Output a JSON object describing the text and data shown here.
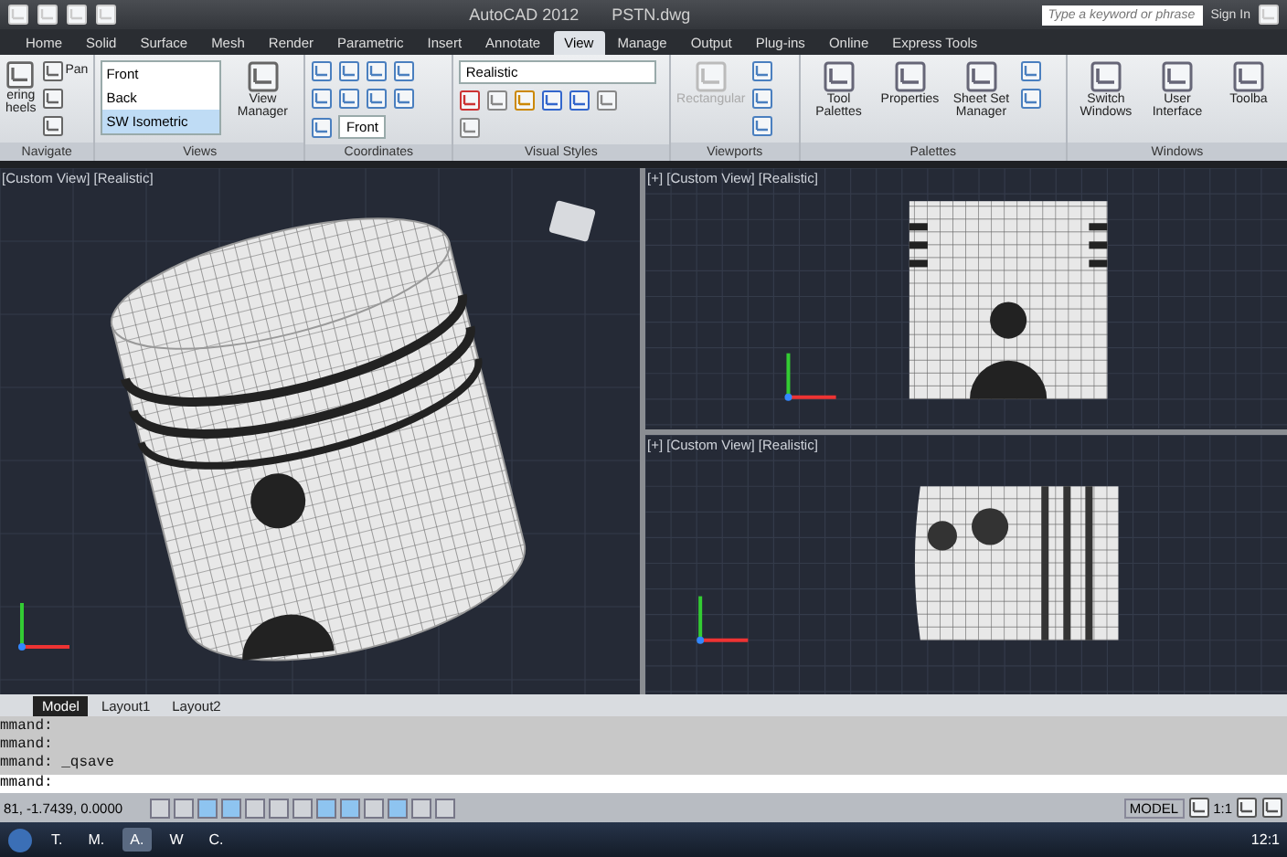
{
  "title_bar": {
    "app": "AutoCAD 2012",
    "file": "PSTN.dwg",
    "search": {
      "placeholder": "Type a keyword or phrase"
    },
    "sign_in": "Sign In"
  },
  "ribbon_tabs": [
    {
      "label": "Home",
      "selected": false
    },
    {
      "label": "Solid",
      "selected": false
    },
    {
      "label": "Surface",
      "selected": false
    },
    {
      "label": "Mesh",
      "selected": false
    },
    {
      "label": "Render",
      "selected": false
    },
    {
      "label": "Parametric",
      "selected": false
    },
    {
      "label": "Insert",
      "selected": false
    },
    {
      "label": "Annotate",
      "selected": false
    },
    {
      "label": "View",
      "selected": true
    },
    {
      "label": "Manage",
      "selected": false
    },
    {
      "label": "Output",
      "selected": false
    },
    {
      "label": "Plug-ins",
      "selected": false
    },
    {
      "label": "Online",
      "selected": false
    },
    {
      "label": "Express Tools",
      "selected": false
    }
  ],
  "ribbon": {
    "navigate": {
      "label": "Navigate",
      "wheel_lines": [
        "ering",
        "heels"
      ],
      "pan": "Pan"
    },
    "views": {
      "label": "Views",
      "items": [
        {
          "label": "Front",
          "selected": false
        },
        {
          "label": "Back",
          "selected": false
        },
        {
          "label": "SW Isometric",
          "selected": true
        }
      ],
      "manager": "View Manager"
    },
    "coordinates": {
      "label": "Coordinates",
      "ucs_value": "Front"
    },
    "visual_styles": {
      "label": "Visual Styles",
      "style_value": "Realistic"
    },
    "viewports": {
      "label": "Viewports",
      "rectangular": {
        "label": "Rectangular",
        "disabled": true
      }
    },
    "palettes": {
      "label": "Palettes",
      "buttons": [
        "Tool Palettes",
        "Properties",
        "Sheet Set Manager"
      ]
    },
    "windows": {
      "label": "Windows",
      "buttons": [
        "Switch Windows",
        "User Interface",
        "Toolba"
      ]
    }
  },
  "viewports": [
    {
      "label": "[Custom View] [Realistic]",
      "kind": "iso"
    },
    {
      "label": "[+] [Custom View] [Realistic]",
      "kind": "front"
    },
    {
      "label": "[+] [Custom View] [Realistic]",
      "kind": "side"
    }
  ],
  "layout_tabs": [
    {
      "label": "Model",
      "selected": true
    },
    {
      "label": "Layout1",
      "selected": false
    },
    {
      "label": "Layout2",
      "selected": false
    }
  ],
  "command_history": [
    "mmand:",
    "mmand:",
    "mmand:  _qsave"
  ],
  "command_prompt": "mmand:",
  "status_bar": {
    "coordinates": "81, -1.7439, 0.0000",
    "toggles": [
      {
        "on": false
      },
      {
        "on": false
      },
      {
        "on": true
      },
      {
        "on": true
      },
      {
        "on": false
      },
      {
        "on": false
      },
      {
        "on": false
      },
      {
        "on": true
      },
      {
        "on": true
      },
      {
        "on": false
      },
      {
        "on": true
      },
      {
        "on": false
      },
      {
        "on": false
      }
    ],
    "space": "MODEL",
    "scale": "1:1"
  },
  "taskbar": {
    "items": [
      {
        "label": "T.",
        "selected": false
      },
      {
        "label": "M.",
        "selected": false
      },
      {
        "label": "A.",
        "selected": true
      },
      {
        "label": "W",
        "selected": false
      },
      {
        "label": "C.",
        "selected": false
      }
    ],
    "clock": "12:1"
  }
}
